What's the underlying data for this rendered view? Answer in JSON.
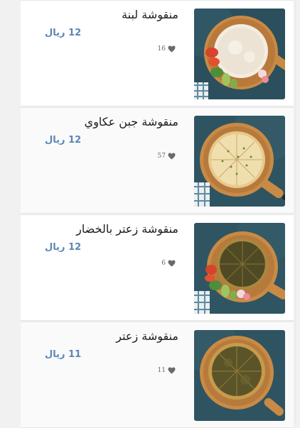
{
  "menu": {
    "items": [
      {
        "name": "منقوشة لبنة",
        "price": "12 ريال",
        "likes": "16",
        "image": "labneh-manakish-image"
      },
      {
        "name": "منقوشة جبن عكاوي",
        "price": "12 ريال",
        "likes": "57",
        "image": "akkawi-cheese-manakish-image"
      },
      {
        "name": "منقوشة زعتر بالخضار",
        "price": "12 ريال",
        "likes": "6",
        "image": "zaatar-vegetables-manakish-image"
      },
      {
        "name": "منقوشة زعتر",
        "price": "11 ريال",
        "likes": "11",
        "image": "zaatar-manakish-image"
      }
    ]
  },
  "colors": {
    "price": "#5a85b8",
    "background": "#2f5562",
    "board": "#c9873f"
  },
  "icons": {
    "like": "heart-icon"
  }
}
